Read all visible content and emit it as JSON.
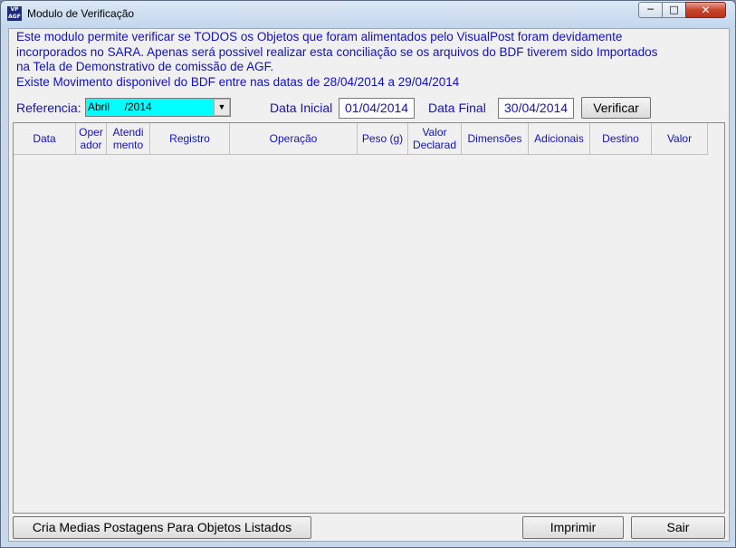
{
  "window": {
    "title": "Modulo de Verificação",
    "controls": {
      "minimize": "─",
      "maximize": "□",
      "close": "✕"
    }
  },
  "info_lines": [
    "Este modulo permite verificar se TODOS os Objetos que foram alimentados pelo VisualPost foram devidamente",
    "incorporados no SARA. Apenas será possivel realizar esta conciliação se os arquivos do BDF tiverem sido Importados",
    "na Tela de Demonstrativo de comissão de AGF.",
    "Existe Movimento disponivel do BDF entre nas datas de 28/04/2014 a 29/04/2014"
  ],
  "filters": {
    "referencia_label": "Referencia:",
    "referencia_value": "Abril     /2014",
    "data_inicial_label": "Data Inicial",
    "data_inicial_value": "01/04/2014",
    "data_final_label": "Data Final",
    "data_final_value": "30/04/2014",
    "verificar_label": "Verificar"
  },
  "columns": [
    "Data",
    "Oper ador",
    "Atendi mento",
    "Registro",
    "Operação",
    "Peso (g)",
    "Valor Declarad",
    "Dimensões",
    "Adicionais",
    "Destino",
    "Valor"
  ],
  "footer": {
    "cria_medias_label": "Cria Medias Postagens Para Objetos Listados",
    "imprimir_label": "Imprimir",
    "sair_label": "Sair"
  },
  "colors": {
    "label_text": "#1010c8",
    "combo_bg": "#00ffff",
    "window_frame": "#c7d8ec",
    "close_button": "#c7452b"
  }
}
